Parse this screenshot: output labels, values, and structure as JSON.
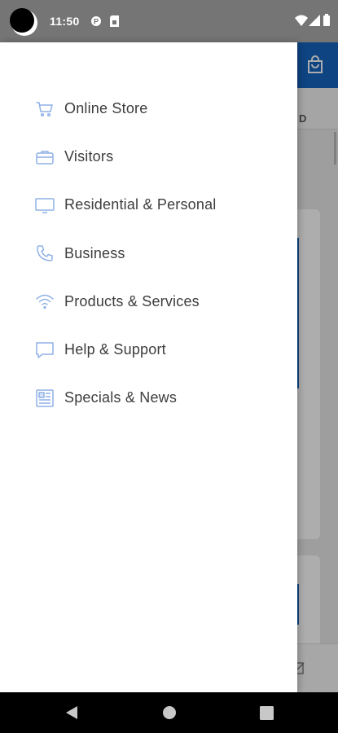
{
  "status_bar": {
    "time": "11:50",
    "icons": [
      "camera-cutout",
      "data-saver-icon",
      "sim-card-icon",
      "wifi-icon",
      "signal-icon",
      "battery-icon"
    ]
  },
  "background_app": {
    "tab_fragment": "D",
    "accent_color": "#1565c0"
  },
  "drawer": {
    "icon_color": "#8fb1e6",
    "items": [
      {
        "label": "Online Store",
        "icon": "cart-icon"
      },
      {
        "label": "Visitors",
        "icon": "briefcase-icon"
      },
      {
        "label": "Residential & Personal",
        "icon": "monitor-icon"
      },
      {
        "label": "Business",
        "icon": "phone-icon"
      },
      {
        "label": "Products & Services",
        "icon": "wifi-icon"
      },
      {
        "label": "Help & Support",
        "icon": "chat-bubble-icon"
      },
      {
        "label": "Specials & News",
        "icon": "newspaper-icon"
      }
    ]
  },
  "nav_bar": {
    "buttons": [
      "back-icon",
      "home-icon",
      "recents-icon"
    ]
  }
}
